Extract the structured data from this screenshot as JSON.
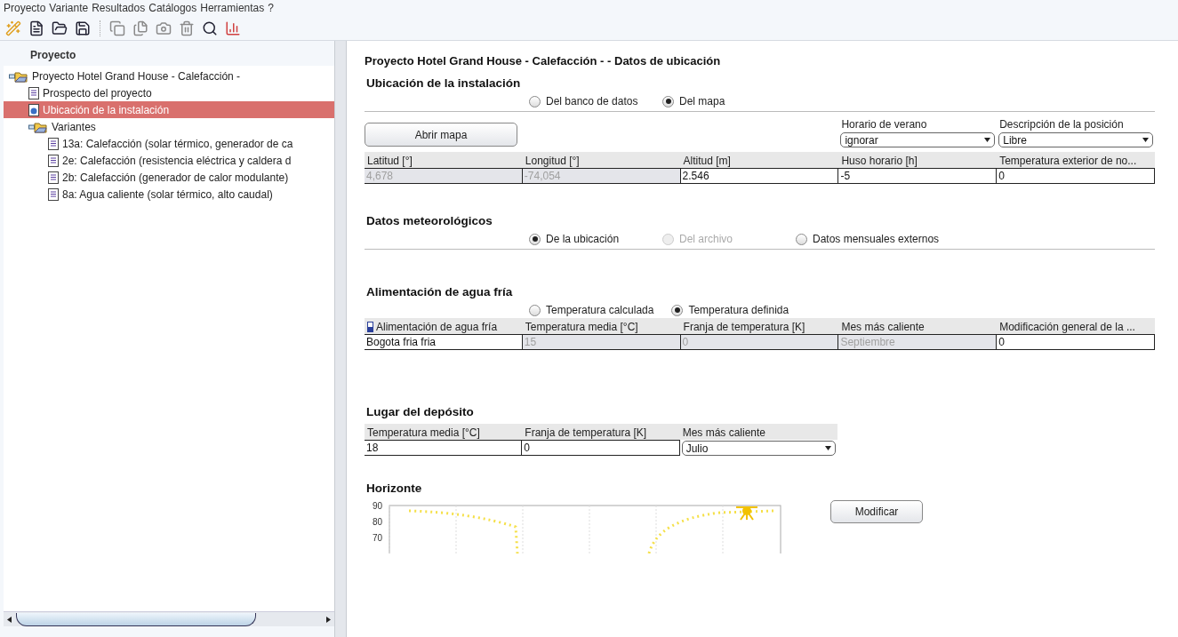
{
  "menu": [
    "Proyecto",
    "Variante",
    "Resultados",
    "Catálogos",
    "Herramientas",
    "?"
  ],
  "toolbar": {
    "groups": [
      [
        {
          "disabled": false
        },
        {
          "disabled": false
        },
        {
          "disabled": false
        },
        {
          "disabled": false
        }
      ],
      [
        {
          "disabled": true
        },
        {
          "disabled": true
        },
        {
          "disabled": true
        },
        {
          "disabled": true
        },
        {
          "disabled": false
        },
        {
          "disabled": false
        }
      ]
    ]
  },
  "sidebar": {
    "title": "Proyecto",
    "tree": [
      {
        "label": "Proyecto Hotel Grand House - Calefacción -",
        "kind": "folder",
        "selected": false,
        "children": [
          {
            "label": "Prospecto del proyecto",
            "kind": "document",
            "selected": false
          },
          {
            "label": "Ubicación de la instalación",
            "kind": "location",
            "selected": true
          },
          {
            "label": "Variantes",
            "kind": "folder",
            "selected": false,
            "children": [
              {
                "label": "13a: Calefacción (solar térmico, generador de ca",
                "kind": "document",
                "selected": false
              },
              {
                "label": "2e: Calefacción (resistencia eléctrica y caldera d",
                "kind": "document",
                "selected": false
              },
              {
                "label": "2b: Calefacción (generador de calor modulante)",
                "kind": "document",
                "selected": false
              },
              {
                "label": "8a: Agua caliente (solar térmico, alto caudal)",
                "kind": "document",
                "selected": false
              }
            ]
          }
        ]
      }
    ]
  },
  "main": {
    "title": "Proyecto Hotel Grand House - Calefacción - - Datos de ubicación",
    "location": {
      "heading": "Ubicación de la instalación",
      "source": [
        {
          "label": "Del banco de datos",
          "selected": false,
          "disabled": false
        },
        {
          "label": "Del mapa",
          "selected": true,
          "disabled": false
        }
      ],
      "open_map_button": "Abrir mapa",
      "options": [
        {
          "label": "Horario de verano",
          "value": "ignorar"
        },
        {
          "label": "Descripción de la posición",
          "value": "Libre"
        }
      ],
      "fields": [
        {
          "label": "Latitud [°]",
          "value": "4,678",
          "kind": "text",
          "disabled": true
        },
        {
          "label": "Longitud [°]",
          "value": "-74,054",
          "kind": "text",
          "disabled": true
        },
        {
          "label": "Altitud [m]",
          "value": "2.546",
          "kind": "text",
          "disabled": false
        },
        {
          "label": "Huso horario [h]",
          "value": "-5",
          "kind": "text",
          "disabled": false
        },
        {
          "label": "Temperatura exterior de no...",
          "value": "0",
          "kind": "text",
          "disabled": false
        }
      ]
    },
    "weather": {
      "heading": "Datos meteorológicos",
      "source": [
        {
          "label": "De la ubicación",
          "selected": true,
          "disabled": false
        },
        {
          "label": "Del archivo",
          "selected": false,
          "disabled": true
        },
        {
          "label": "Datos mensuales externos",
          "selected": false,
          "disabled": false
        }
      ]
    },
    "cold_water": {
      "heading": "Alimentación de agua fría",
      "source": [
        {
          "label": "Temperatura calculada",
          "selected": false,
          "disabled": false
        },
        {
          "label": "Temperatura definida",
          "selected": true,
          "disabled": false
        }
      ],
      "fields": [
        {
          "label": "Alimentación de agua fría",
          "value": "Bogota fria fria",
          "kind": "text",
          "disabled": false,
          "icon": true
        },
        {
          "label": "Temperatura media [°C]",
          "value": "15",
          "kind": "text",
          "disabled": true
        },
        {
          "label": "Franja de temperatura [K]",
          "value": "0",
          "kind": "text",
          "disabled": true
        },
        {
          "label": "Mes más caliente",
          "value": "Septiembre",
          "kind": "text",
          "disabled": true
        },
        {
          "label": "Modificación general de la ...",
          "value": "0",
          "kind": "text",
          "disabled": false
        }
      ]
    },
    "tank": {
      "heading": "Lugar del depósito",
      "fields": [
        {
          "label": "Temperatura media [°C]",
          "value": "18",
          "kind": "text",
          "disabled": false
        },
        {
          "label": "Franja de temperatura [K]",
          "value": "0",
          "kind": "text",
          "disabled": false
        },
        {
          "label": "Mes más caliente",
          "value": "Julio",
          "kind": "combo",
          "disabled": false
        }
      ]
    },
    "horizon": {
      "heading": "Horizonte",
      "y_ticks": [
        "90",
        "80",
        "70"
      ],
      "modify_button": "Modificar"
    }
  }
}
